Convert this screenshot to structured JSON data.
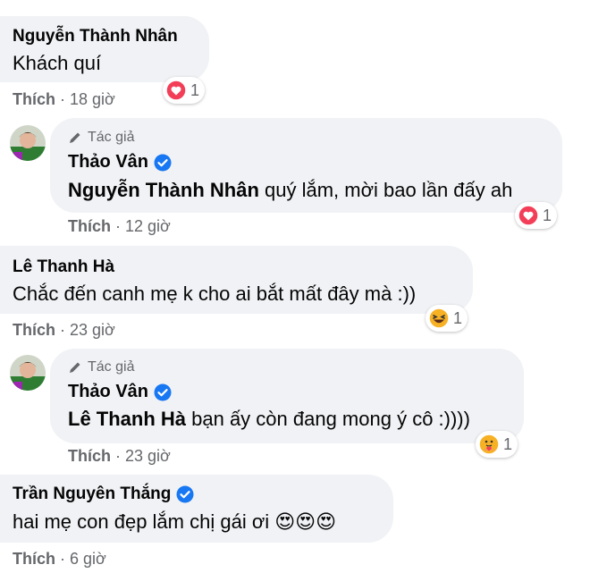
{
  "comments": [
    {
      "author": "Nguyễn Thành Nhân",
      "text": "Khách quí",
      "action": "Thích",
      "time": "· 18 giờ",
      "reaction": {
        "icon": "heart-icon",
        "count": "1"
      }
    },
    {
      "badge": "Tác giả",
      "author": "Thảo Vân",
      "verified": true,
      "mention": "Nguyễn Thành Nhân",
      "text": " quý lắm, mời bao lần đấy ah",
      "action": "Thích",
      "time": "· 12 giờ",
      "reaction": {
        "icon": "heart-icon",
        "count": "1"
      }
    },
    {
      "author": "Lê Thanh Hà",
      "text": "Chắc đến canh mẹ k cho ai bắt mất đây mà :))",
      "action": "Thích",
      "time": "· 23 giờ",
      "reaction": {
        "icon": "haha-icon",
        "count": "1"
      }
    },
    {
      "badge": "Tác giả",
      "author": "Thảo Vân",
      "verified": true,
      "mention": "Lê Thanh Hà",
      "text": " bạn ấy còn đang mong ý cô :))))",
      "action": "Thích",
      "time": "· 23 giờ",
      "reaction": {
        "icon": "care-icon",
        "count": "1"
      }
    },
    {
      "author": "Trần Nguyên Thắng",
      "verified": true,
      "text": "hai mẹ con đẹp lắm chị gái ơi 😍😍😍",
      "action": "Thích",
      "time": "· 6 giờ"
    }
  ],
  "colors": {
    "bubble": "#f0f2f5",
    "secondary_text": "#65676b",
    "verified": "#1877f2",
    "love": "#f33e58",
    "haha": "#f7b125"
  }
}
